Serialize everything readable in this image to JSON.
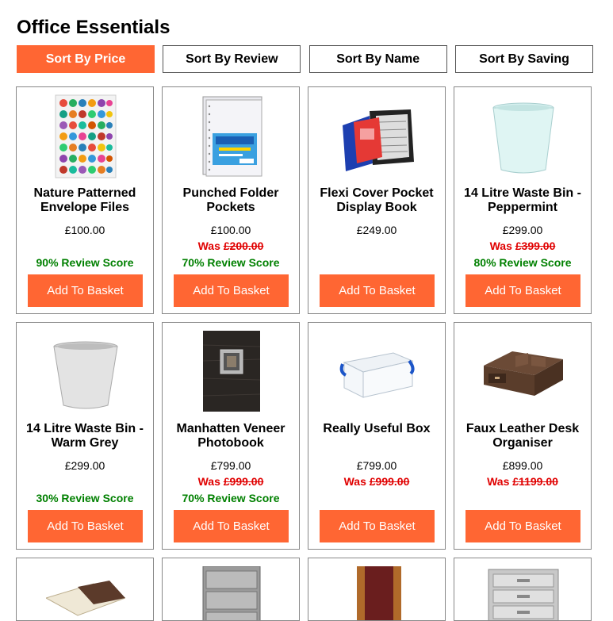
{
  "page": {
    "title": "Office Essentials"
  },
  "sort": [
    {
      "label": "Sort By Price",
      "active": true
    },
    {
      "label": "Sort By Review",
      "active": false
    },
    {
      "label": "Sort By Name",
      "active": false
    },
    {
      "label": "Sort By Saving",
      "active": false
    }
  ],
  "colors": {
    "accent": "#ff6633",
    "was": "#e00000",
    "review": "#008000"
  },
  "products": [
    {
      "name": "Nature Patterned Envelope Files",
      "price": "£100.00",
      "was_prefix": "",
      "was_value": "",
      "review": "90% Review Score",
      "basket": "Add To Basket",
      "image": "owl-pattern-envelope-image"
    },
    {
      "name": "Punched Folder Pockets",
      "price": "£100.00",
      "was_prefix": "Was ",
      "was_value": "£200.00",
      "review": "70% Review Score",
      "basket": "Add To Basket",
      "image": "punched-pockets-image"
    },
    {
      "name": "Flexi Cover Pocket Display Book",
      "price": "£249.00",
      "was_prefix": "",
      "was_value": "",
      "review": "",
      "basket": "Add To Basket",
      "image": "display-book-image"
    },
    {
      "name": "14 Litre Waste Bin - Peppermint",
      "price": "£299.00",
      "was_prefix": "Was ",
      "was_value": "£399.00",
      "review": "80% Review Score",
      "basket": "Add To Basket",
      "image": "peppermint-bin-image"
    },
    {
      "name": "14 Litre Waste Bin - Warm Grey",
      "price": "£299.00",
      "was_prefix": "",
      "was_value": "",
      "review": "30% Review Score",
      "basket": "Add To Basket",
      "image": "grey-bin-image"
    },
    {
      "name": "Manhatten Veneer Photobook",
      "price": "£799.00",
      "was_prefix": "Was ",
      "was_value": "£999.00",
      "review": "70% Review Score",
      "basket": "Add To Basket",
      "image": "photobook-image"
    },
    {
      "name": "Really Useful Box",
      "price": "£799.00",
      "was_prefix": "Was ",
      "was_value": "£999.00",
      "review": "",
      "basket": "Add To Basket",
      "image": "storage-box-image"
    },
    {
      "name": "Faux Leather Desk Organiser",
      "price": "£899.00",
      "was_prefix": "Was ",
      "was_value": "£1199.00",
      "review": "",
      "basket": "Add To Basket",
      "image": "desk-organiser-image"
    }
  ],
  "partial_products": [
    {
      "image": "book-stack-image"
    },
    {
      "image": "mesh-drawer-unit-image"
    },
    {
      "image": "red-book-image"
    },
    {
      "image": "silver-drawer-unit-image"
    }
  ]
}
